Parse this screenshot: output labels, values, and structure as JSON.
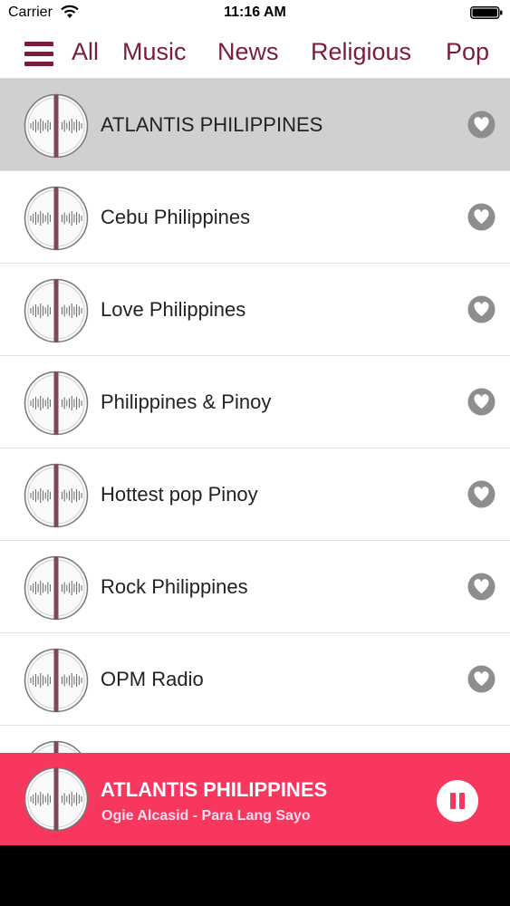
{
  "status_bar": {
    "carrier": "Carrier",
    "time": "11:16 AM",
    "wifi_icon": "wifi-icon",
    "battery_icon": "battery-icon"
  },
  "nav": {
    "menu_icon": "hamburger-menu-icon",
    "tabs": [
      {
        "label": "All"
      },
      {
        "label": "Music"
      },
      {
        "label": "News"
      },
      {
        "label": "Religious"
      },
      {
        "label": "Pop"
      }
    ]
  },
  "stations": [
    {
      "name": "ATLANTIS PHILIPPINES",
      "selected": true
    },
    {
      "name": "Cebu Philippines"
    },
    {
      "name": "Love Philippines"
    },
    {
      "name": "Philippines & Pinoy"
    },
    {
      "name": "Hottest pop Pinoy"
    },
    {
      "name": "Rock Philippines"
    },
    {
      "name": "OPM Radio"
    }
  ],
  "now_playing": {
    "station": "ATLANTIS PHILIPPINES",
    "track": "Ogie Alcasid - Para Lang Sayo",
    "control_icon": "pause-icon"
  },
  "colors": {
    "accent": "#7a1b3f",
    "player_bar": "#f8375f",
    "selected_row": "#d0d0d0",
    "fav_icon": "#8e8e8e"
  }
}
